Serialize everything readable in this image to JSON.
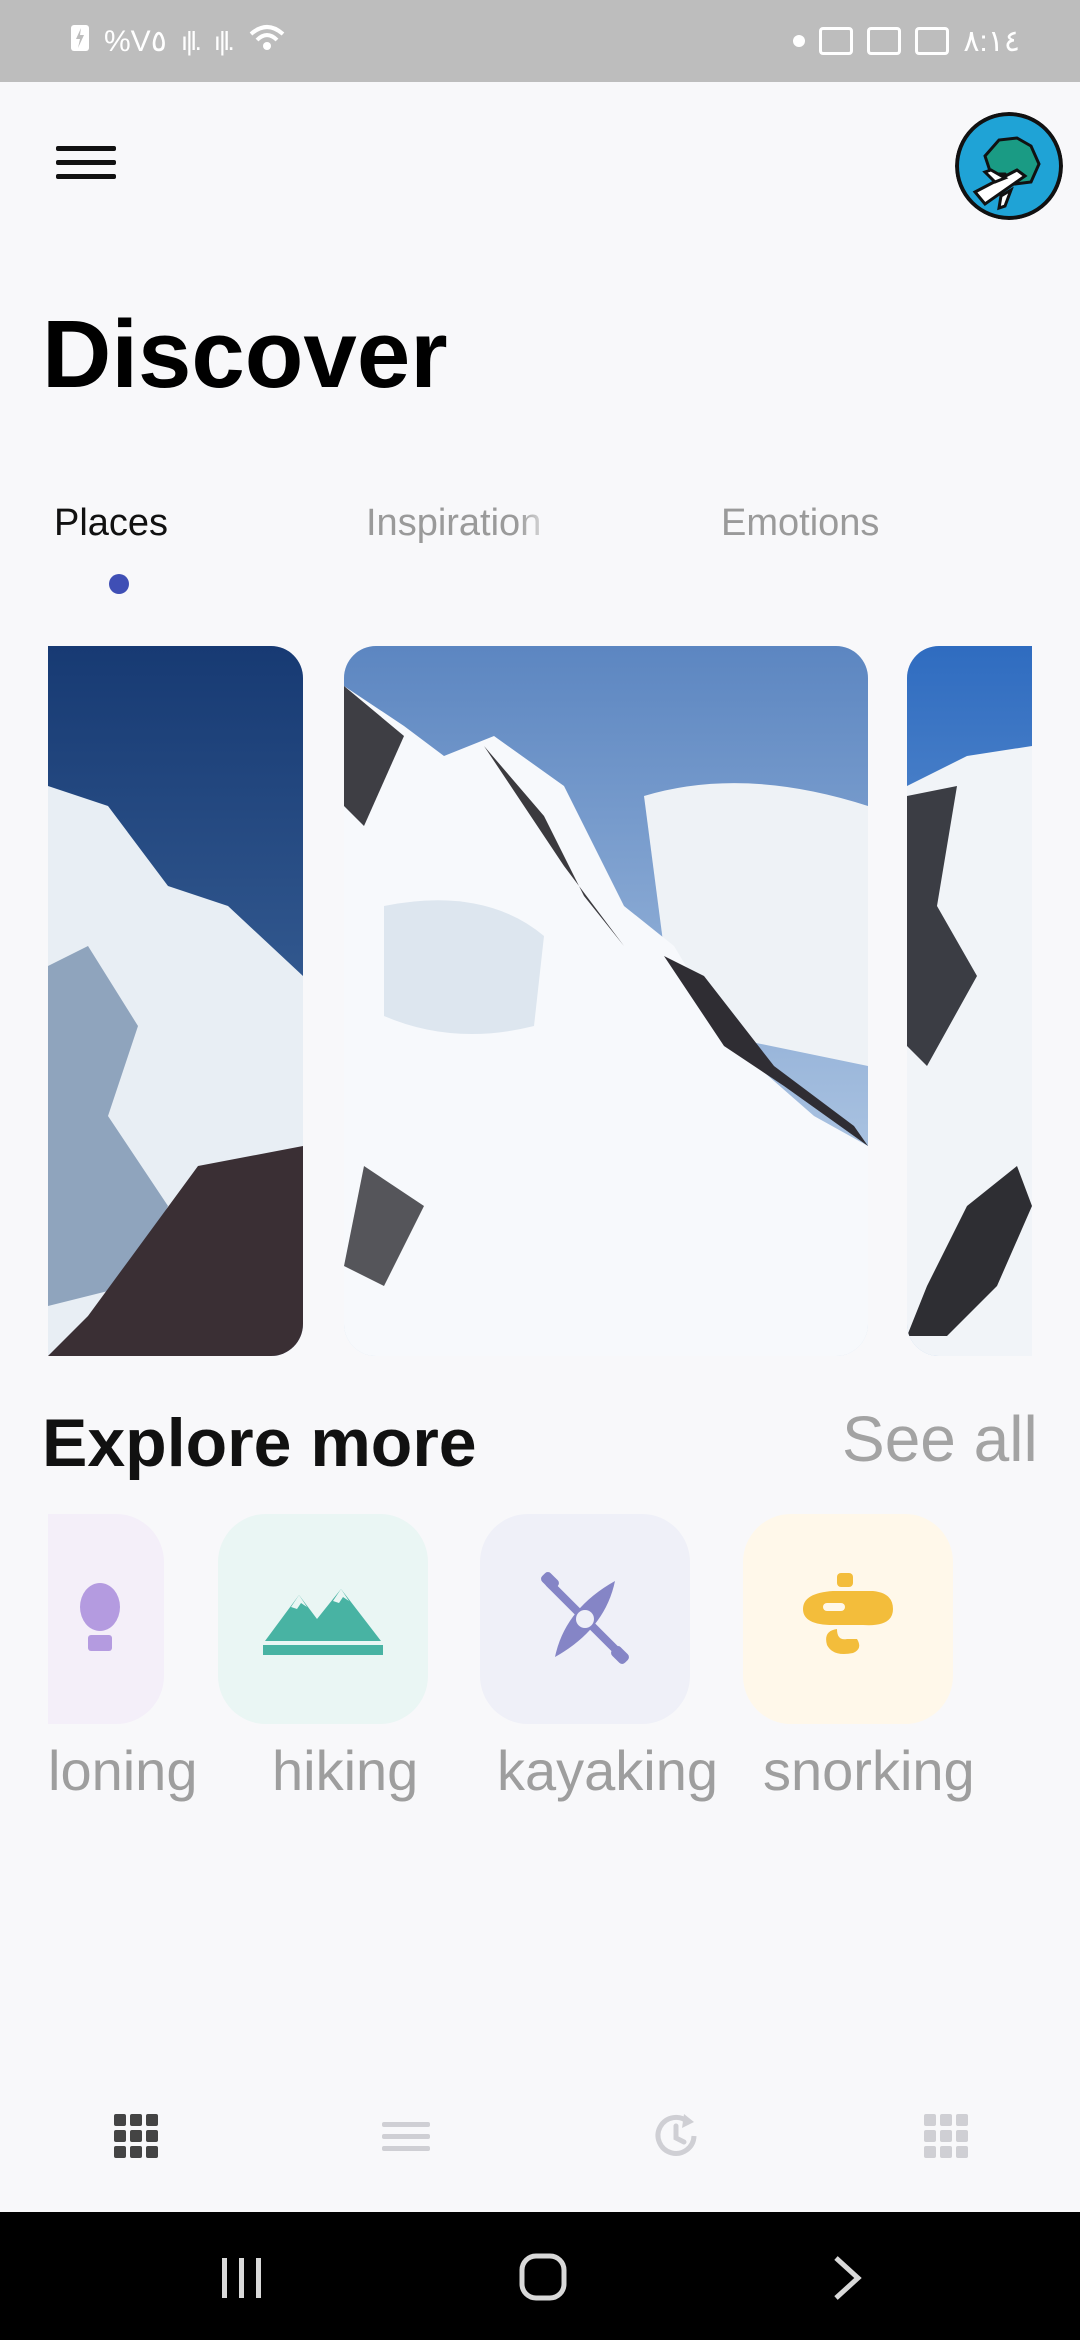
{
  "status_bar": {
    "battery_text": "%V٥",
    "time": "٨:١٤"
  },
  "header": {
    "title": "Discover"
  },
  "tabs": [
    {
      "label": "Places",
      "active": true
    },
    {
      "label": "Inspiration",
      "active": false
    },
    {
      "label": "Emotions",
      "active": false
    }
  ],
  "explore": {
    "title": "Explore more",
    "see_all": "See all",
    "categories": [
      {
        "label": "loning",
        "icon": "balloon-icon",
        "bg": "#f4eff9",
        "color": "#b49be0"
      },
      {
        "label": "hiking",
        "icon": "mountains-icon",
        "bg": "#eaf6f4",
        "color": "#48b3a3"
      },
      {
        "label": "kayaking",
        "icon": "kayak-icon",
        "bg": "#eff0f8",
        "color": "#8585c6"
      },
      {
        "label": "snorking",
        "icon": "snorkel-mask-icon",
        "bg": "#fff8ea",
        "color": "#f3bd3b"
      }
    ]
  },
  "colors": {
    "accent": "#3f4fb5",
    "muted_text": "#9e9e9e"
  }
}
